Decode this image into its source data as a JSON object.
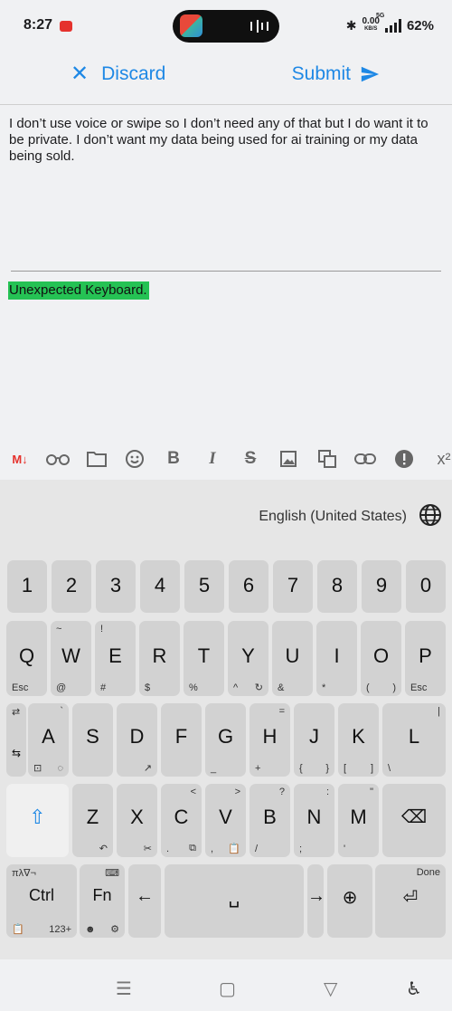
{
  "status_bar": {
    "time": "8:27",
    "speed_value": "0.00",
    "speed_unit": "KB/S",
    "network": "5G",
    "battery": "62%"
  },
  "app_bar": {
    "discard_label": "Discard",
    "submit_label": "Submit"
  },
  "editor": {
    "body_text": "I don’t use voice or swipe so I don’t need any of that but I do want it to be private. I don’t want my data being used for ai training or my data being sold.",
    "highlighted_text": "Unexpected Keyboard."
  },
  "toolbar": {
    "markdown": "M↓",
    "bold": "B",
    "italic": "I",
    "strike": "S",
    "superscript": "x²"
  },
  "keyboard": {
    "language": "English (United States)",
    "rows": [
      [
        {
          "m": "1"
        },
        {
          "m": "2"
        },
        {
          "m": "3"
        },
        {
          "m": "4"
        },
        {
          "m": "5"
        },
        {
          "m": "6"
        },
        {
          "m": "7"
        },
        {
          "m": "8"
        },
        {
          "m": "9"
        },
        {
          "m": "0"
        }
      ],
      [
        {
          "m": "Q",
          "bl": "Esc"
        },
        {
          "m": "W",
          "tl": "~",
          "bl": "@"
        },
        {
          "m": "E",
          "tl": "!",
          "bl": "#"
        },
        {
          "m": "R",
          "bl": "$"
        },
        {
          "m": "T",
          "bl": "%"
        },
        {
          "m": "Y",
          "bl": "^",
          "br": "↻"
        },
        {
          "m": "U",
          "bl": "&"
        },
        {
          "m": "I",
          "bl": "*"
        },
        {
          "m": "O",
          "bl": "(",
          "br": ")"
        },
        {
          "m": "P",
          "bl": "Esc"
        }
      ],
      [
        {
          "m": "⇆",
          "tl": "⇄",
          "small": true
        },
        {
          "m": "A",
          "tr": "`",
          "bl": "⊡",
          "br": "◌"
        },
        {
          "m": "S"
        },
        {
          "m": "D",
          "br": "↗"
        },
        {
          "m": "F"
        },
        {
          "m": "G",
          "bl": "_"
        },
        {
          "m": "H",
          "tr": "=",
          "bl": "+"
        },
        {
          "m": "J",
          "bl": "{",
          "br": "}"
        },
        {
          "m": "K",
          "bl": "[",
          "br": "]"
        },
        {
          "m": "L",
          "tr": "|",
          "bl": "\\"
        }
      ],
      [
        {
          "m": "⇧"
        },
        {
          "m": "Z",
          "br": "↶"
        },
        {
          "m": "X",
          "br": "✂"
        },
        {
          "m": "C",
          "tr": "<",
          "bl": ".",
          "br": "⧉"
        },
        {
          "m": "V",
          "tr": ">",
          "bl": ",",
          "br": "📋"
        },
        {
          "m": "B",
          "tr": "?",
          "bl": "/"
        },
        {
          "m": "N",
          "tr": ":",
          "bl": ";"
        },
        {
          "m": "M",
          "tr": "\"",
          "bl": "'"
        },
        {
          "m": "⌫"
        }
      ],
      [
        {
          "m": "Ctrl",
          "tl": "πλ∇¬",
          "bl": "📋",
          "br": "123+"
        },
        {
          "m": "Fn",
          "tr": "⌨",
          "bl": "☻",
          "br": "⚙"
        },
        {
          "m": "←"
        },
        {
          "m": "␣"
        },
        {
          "m": "→"
        },
        {
          "m": "⊕"
        },
        {
          "m": "⏎",
          "tr": "Done"
        }
      ]
    ]
  },
  "nav": {
    "recents": "☰",
    "home": "▢",
    "back": "▽",
    "accessibility": "♿"
  }
}
